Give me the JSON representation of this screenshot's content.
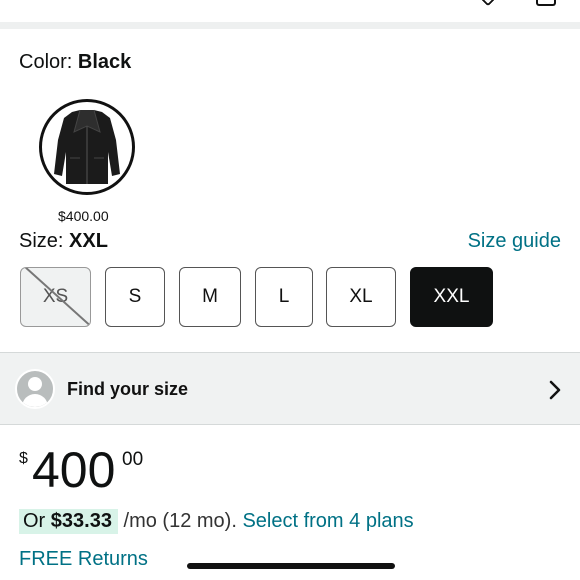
{
  "color": {
    "label": "Color:",
    "value": "Black"
  },
  "swatch": {
    "price": "$400.00",
    "image_icon": "leather-jacket-icon"
  },
  "size": {
    "label": "Size:",
    "value": "XXL",
    "guide_link": "Size guide"
  },
  "sizes": [
    {
      "label": "XS",
      "state": "unavailable"
    },
    {
      "label": "S",
      "state": "available"
    },
    {
      "label": "M",
      "state": "available"
    },
    {
      "label": "L",
      "state": "available"
    },
    {
      "label": "XL",
      "state": "available"
    },
    {
      "label": "XXL",
      "state": "selected"
    }
  ],
  "find_size": {
    "label": "Find your size",
    "icon": "avatar-icon",
    "chevron": "chevron-right-icon"
  },
  "price": {
    "currency": "$",
    "whole": "400",
    "fraction": "00"
  },
  "monthly": {
    "prefix": "Or",
    "amount": "$33.33",
    "term": "/mo (12 mo).",
    "link": "Select from 4 plans"
  },
  "returns": {
    "label": "FREE Returns"
  },
  "colors": {
    "accent_link": "#007185",
    "selected_bg": "#0f1111",
    "installment_highlight": "#d8f3e8",
    "bar_bg": "#f0f2f2"
  }
}
